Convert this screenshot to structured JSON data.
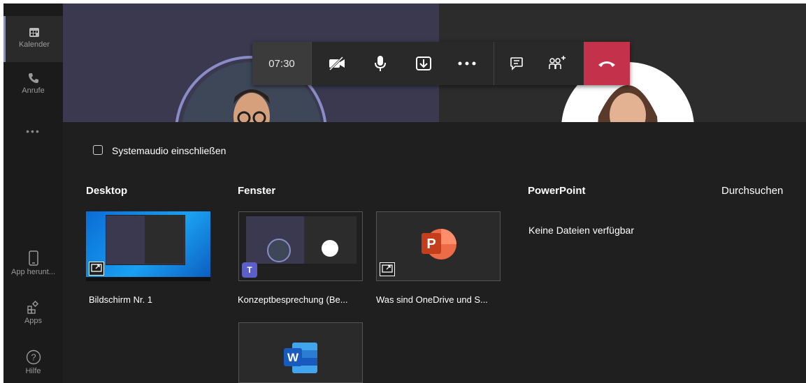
{
  "rail": {
    "calendar_label": "Kalender",
    "calls_label": "Anrufe",
    "more_label": "•••",
    "download_label": "App herunt...",
    "apps_label": "Apps",
    "help_label": "Hilfe"
  },
  "controls": {
    "timer": "07:30"
  },
  "share": {
    "include_system_audio_label": "Systemaudio einschließen",
    "desktop_heading": "Desktop",
    "window_heading": "Fenster",
    "powerpoint_heading": "PowerPoint",
    "browse_label": "Durchsuchen",
    "no_files_label": "Keine Dateien verfügbar",
    "desktop_items": [
      {
        "label": "Bildschirm Nr. 1"
      }
    ],
    "window_items": [
      {
        "label": "Konzeptbesprechung (Be..."
      },
      {
        "label": "Was sind OneDrive und S..."
      },
      {
        "label": ""
      }
    ]
  },
  "colors": {
    "accent": "#8b8cc7",
    "hangup": "#c4314b",
    "background": "#1f1f1f"
  }
}
